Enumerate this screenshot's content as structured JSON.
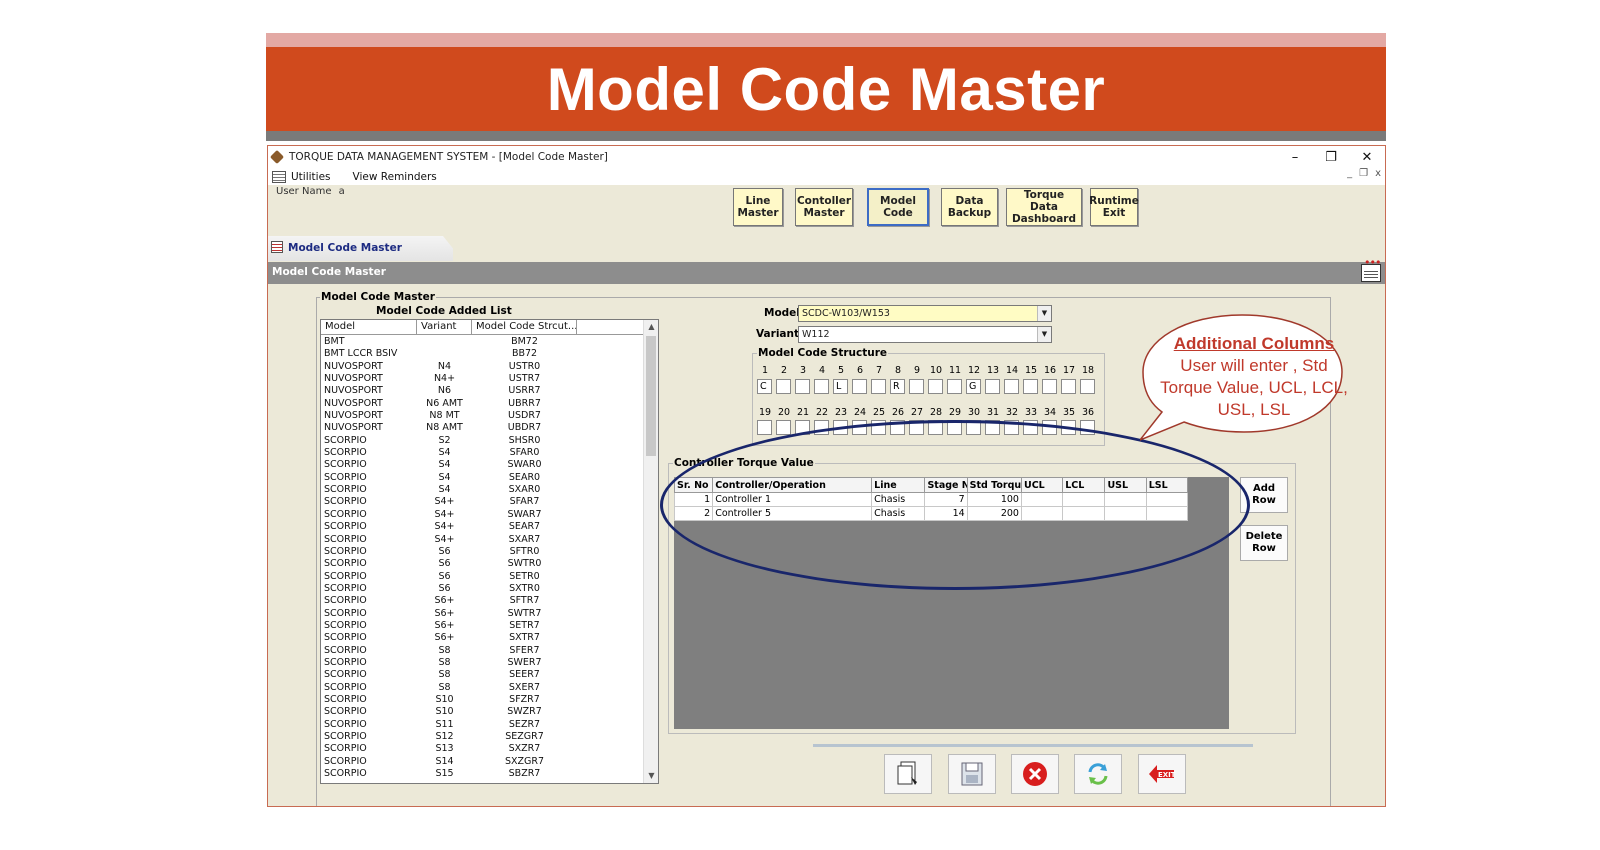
{
  "slide": {
    "title": "Model Code Master"
  },
  "window": {
    "title": "TORQUE DATA MANAGEMENT SYSTEM - [Model Code Master]",
    "controls": {
      "minimize": "–",
      "restore": "❐",
      "close": "✕"
    },
    "mdi_controls": {
      "minimize": "_",
      "restore": "❐",
      "close": "x"
    }
  },
  "menu": {
    "items": [
      "Utilities",
      "View Reminders"
    ]
  },
  "user": {
    "label": "User Name",
    "value": "a"
  },
  "toolbar": {
    "line_master": "Line\nMaster",
    "controller_master": "Contoller\nMaster",
    "model_code": "Model\nCode",
    "data_backup": "Data\nBackup",
    "torque_dashboard": "Torque Data\nDashboard",
    "runtime_exit": "Runtime\nExit"
  },
  "tab": {
    "label": "Model Code Master"
  },
  "section": {
    "title": "Model Code Master"
  },
  "master": {
    "legend": "Model Code Master",
    "list_title": "Model Code Added List",
    "columns": [
      "Model",
      "Variant",
      "Model Code Strcut..."
    ],
    "rows": [
      [
        "BMT",
        "",
        "BM72"
      ],
      [
        "BMT LCCR BSIV",
        "",
        "BB72"
      ],
      [
        "NUVOSPORT",
        "N4",
        "USTR0"
      ],
      [
        "NUVOSPORT",
        "N4+",
        "USTR7"
      ],
      [
        "NUVOSPORT",
        "N6",
        "USRR7"
      ],
      [
        "NUVOSPORT",
        "N6 AMT",
        "UBRR7"
      ],
      [
        "NUVOSPORT",
        "N8 MT",
        "USDR7"
      ],
      [
        "NUVOSPORT",
        "N8 AMT",
        "UBDR7"
      ],
      [
        "SCORPIO",
        "S2",
        "SHSR0"
      ],
      [
        "SCORPIO",
        "S4",
        "SFAR0"
      ],
      [
        "SCORPIO",
        "S4",
        "SWAR0"
      ],
      [
        "SCORPIO",
        "S4",
        "SEAR0"
      ],
      [
        "SCORPIO",
        "S4",
        "SXAR0"
      ],
      [
        "SCORPIO",
        "S4+",
        "SFAR7"
      ],
      [
        "SCORPIO",
        "S4+",
        "SWAR7"
      ],
      [
        "SCORPIO",
        "S4+",
        "SEAR7"
      ],
      [
        "SCORPIO",
        "S4+",
        "SXAR7"
      ],
      [
        "SCORPIO",
        "S6",
        "SFTR0"
      ],
      [
        "SCORPIO",
        "S6",
        "SWTR0"
      ],
      [
        "SCORPIO",
        "S6",
        "SETR0"
      ],
      [
        "SCORPIO",
        "S6",
        "SXTR0"
      ],
      [
        "SCORPIO",
        "S6+",
        "SFTR7"
      ],
      [
        "SCORPIO",
        "S6+",
        "SWTR7"
      ],
      [
        "SCORPIO",
        "S6+",
        "SETR7"
      ],
      [
        "SCORPIO",
        "S6+",
        "SXTR7"
      ],
      [
        "SCORPIO",
        "S8",
        "SFER7"
      ],
      [
        "SCORPIO",
        "S8",
        "SWER7"
      ],
      [
        "SCORPIO",
        "S8",
        "SEER7"
      ],
      [
        "SCORPIO",
        "S8",
        "SXER7"
      ],
      [
        "SCORPIO",
        "S10",
        "SFZR7"
      ],
      [
        "SCORPIO",
        "S10",
        "SWZR7"
      ],
      [
        "SCORPIO",
        "S11",
        "SEZR7"
      ],
      [
        "SCORPIO",
        "S12",
        "SEZGR7"
      ],
      [
        "SCORPIO",
        "S13",
        "SXZR7"
      ],
      [
        "SCORPIO",
        "S14",
        "SXZGR7"
      ],
      [
        "SCORPIO",
        "S15",
        "SBZR7"
      ]
    ]
  },
  "form": {
    "model_label": "Model",
    "model_value": "SCDC-W103/W153",
    "variant_label": "Variant",
    "variant_value": "W112"
  },
  "structure": {
    "legend": "Model Code Structure",
    "numbers_row1": [
      "1",
      "2",
      "3",
      "4",
      "5",
      "6",
      "7",
      "8",
      "9",
      "10",
      "11",
      "12",
      "13",
      "14",
      "15",
      "16",
      "17",
      "18"
    ],
    "values_row1": [
      "C",
      "",
      "",
      "",
      "L",
      "",
      "",
      "R",
      "",
      "",
      "",
      "G",
      "",
      "",
      "",
      "",
      "",
      ""
    ],
    "numbers_row2": [
      "19",
      "20",
      "21",
      "22",
      "23",
      "24",
      "25",
      "26",
      "27",
      "28",
      "29",
      "30",
      "31",
      "32",
      "33",
      "34",
      "35",
      "36"
    ]
  },
  "torque": {
    "legend": "Controller Torque Value",
    "columns": [
      "Sr. No",
      "Controller/Operation",
      "Line",
      "Stage N",
      "Std Torqu",
      "UCL",
      "LCL",
      "USL",
      "LSL"
    ],
    "rows": [
      [
        "1",
        "Controller 1",
        "Chasis",
        "7",
        "100",
        "",
        "",
        "",
        ""
      ],
      [
        "2",
        "Controller 5",
        "Chasis",
        "14",
        "200",
        "",
        "",
        "",
        ""
      ]
    ],
    "add_row": "Add\nRow",
    "delete_row": "Delete\nRow"
  },
  "annotation": {
    "heading": "Additional Columns",
    "body": "User will enter , Std Torque Value, UCL, LCL, USL, LSL"
  },
  "colors": {
    "banner": "#d04a1d",
    "annotation": "#c0392b",
    "ellipse": "#19266b"
  }
}
